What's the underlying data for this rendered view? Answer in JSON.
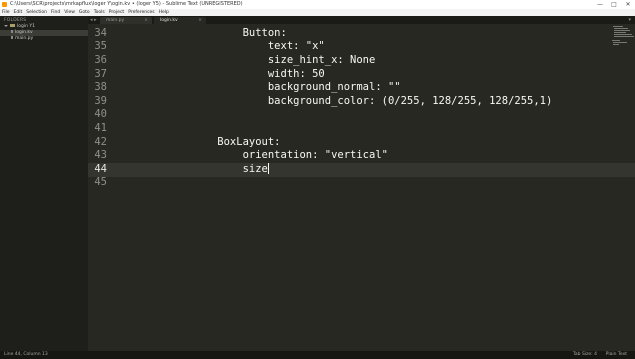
{
  "window": {
    "title": "C:\\Users\\SCR\\projects\\mrkapflux\\loger Y\\ogin.kv • (loger Y5) - Sublime Text (UNREGISTERED)",
    "controls": [
      "—",
      "□",
      "✕"
    ]
  },
  "menubar": [
    "File",
    "Edit",
    "Selection",
    "Find",
    "View",
    "Goto",
    "Tools",
    "Project",
    "Preferences",
    "Help"
  ],
  "sidebar": {
    "header": "FOLDERS",
    "items": [
      {
        "label": "login Y1",
        "kind": "folder",
        "selected": false
      },
      {
        "label": "login.kv",
        "kind": "file",
        "selected": true
      },
      {
        "label": "main.py",
        "kind": "file",
        "selected": false
      }
    ]
  },
  "tabs": {
    "nav_left": "◂ ▸",
    "menu": "▾",
    "items": [
      {
        "label": "main.py",
        "active": false,
        "close": "×"
      },
      {
        "label": "login.kv",
        "active": true,
        "close": "×"
      }
    ]
  },
  "editor": {
    "current_line": 44,
    "lines": [
      {
        "num": "34",
        "text": "        Button:"
      },
      {
        "num": "35",
        "text": "            text: \"x\""
      },
      {
        "num": "36",
        "text": "            size_hint_x: None"
      },
      {
        "num": "37",
        "text": "            width: 50"
      },
      {
        "num": "38",
        "text": "            background_normal: \"\""
      },
      {
        "num": "39",
        "text": "            background_color: (0/255, 128/255, 128/255,1)"
      },
      {
        "num": "40",
        "text": ""
      },
      {
        "num": "41",
        "text": ""
      },
      {
        "num": "42",
        "text": "    BoxLayout:"
      },
      {
        "num": "43",
        "text": "        orientation: \"vertical\""
      },
      {
        "num": "44",
        "text": "        size"
      },
      {
        "num": "45",
        "text": ""
      }
    ]
  },
  "statusbar": {
    "position": "Line 44, Column 13",
    "tab_size": "Tab Size: 4",
    "syntax": "Plain Text"
  },
  "colors": {
    "editor_bg": "#272822",
    "sidebar_bg": "#1e1f1a",
    "text": "#f8f8f2",
    "line_numbers": "#8f908a"
  }
}
